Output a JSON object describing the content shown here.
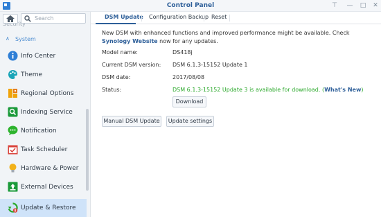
{
  "window": {
    "title": "Control Panel",
    "pin_glyph": "⊤",
    "minimize_glyph": "—",
    "maximize_glyph": "□",
    "close_glyph": "✕"
  },
  "sidebar": {
    "search_placeholder": "Search",
    "prev_item_peek": "Security",
    "group_label": "System",
    "items": [
      {
        "label": "Info Center",
        "icon": "info-icon",
        "color": "#2f7fd6"
      },
      {
        "label": "Theme",
        "icon": "palette-icon",
        "color": "#1aa5b8"
      },
      {
        "label": "Regional Options",
        "icon": "clock-icon",
        "color": "#f0a30a"
      },
      {
        "label": "Indexing Service",
        "icon": "magnifier-icon",
        "color": "#1b9a3a"
      },
      {
        "label": "Notification",
        "icon": "chat-bubble-icon",
        "color": "#2db32d"
      },
      {
        "label": "Task Scheduler",
        "icon": "calendar-check-icon",
        "color": "#d9433b"
      },
      {
        "label": "Hardware & Power",
        "icon": "lightbulb-icon",
        "color": "#f2b21a"
      },
      {
        "label": "External Devices",
        "icon": "usb-upload-icon",
        "color": "#1b9a3a"
      },
      {
        "label": "Update & Restore",
        "icon": "update-restore-icon",
        "color": "#2aa82a",
        "active": true
      }
    ]
  },
  "tabs": [
    {
      "label": "DSM Update",
      "active": true
    },
    {
      "label": "Configuration Backup",
      "active": false
    },
    {
      "label": "Reset",
      "active": false
    }
  ],
  "main": {
    "notice_pre": "New DSM with enhanced functions and improved performance might be available. Check ",
    "notice_link": "Synology Website",
    "notice_post": " now for any updates.",
    "fields": [
      {
        "label": "Model name:",
        "value": "DS418j"
      },
      {
        "label": "Current DSM version:",
        "value": "DSM 6.1.3-15152 Update 1"
      },
      {
        "label": "DSM date:",
        "value": "2017/08/08"
      }
    ],
    "status_label": "Status:",
    "status_text": "DSM 6.1.3-15152 Update 3 is available for download. (",
    "status_link": "What's New",
    "status_close": ")",
    "download_label": "Download",
    "manual_update_label": "Manual DSM Update",
    "update_settings_label": "Update settings"
  },
  "colors": {
    "accent": "#2e5f99",
    "success": "#2aa82a",
    "active_bg": "#cfe3f9"
  }
}
